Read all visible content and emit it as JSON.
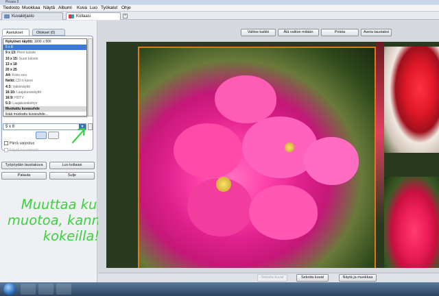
{
  "window": {
    "title": "Picasa 3"
  },
  "menu": [
    "Tiedosto",
    "Muokkaa",
    "Näytä",
    "Albumi",
    "Kuva",
    "Luo",
    "Työkalut",
    "Ohje"
  ],
  "app_tabs": [
    {
      "label": "Kuvakirjasto"
    },
    {
      "label": "Kollaasi"
    }
  ],
  "panel_tabs": {
    "settings": "Asetukset",
    "clips": "Otokset (0)"
  },
  "dropdown": {
    "items": [
      {
        "name": "Nykyinen näyttö:",
        "desc": "1600 x 900",
        "style": "head"
      },
      {
        "name": "5 x 8",
        "desc": "",
        "style": "sel"
      },
      {
        "name": "9 x 13:",
        "desc": "Pieni tuloste",
        "style": ""
      },
      {
        "name": "10 x 15:",
        "desc": "Suuri tuloste",
        "style": ""
      },
      {
        "name": "13 x 18",
        "desc": "",
        "style": ""
      },
      {
        "name": "20 x 25",
        "desc": "",
        "style": ""
      },
      {
        "name": "A4:",
        "desc": "Koko sivu",
        "style": ""
      },
      {
        "name": "Neliö:",
        "desc": "CD:n kansi",
        "style": ""
      },
      {
        "name": "4:3:",
        "desc": "Vakionäyttö",
        "style": ""
      },
      {
        "name": "16:10:",
        "desc": "Laajakuvanäyttö",
        "style": ""
      },
      {
        "name": "16:9:",
        "desc": "HDTV",
        "style": ""
      },
      {
        "name": "5:3:",
        "desc": "Laajakuvakehys",
        "style": ""
      },
      {
        "name": "Muokattu kuvasuhde",
        "desc": "",
        "style": "head grey"
      },
      {
        "name": "lisää muokattu kuvasuhde...",
        "desc": "",
        "style": ""
      }
    ],
    "selected_value": "5 x 8"
  },
  "options": {
    "draw_shadows": "Piirrä varjostus",
    "show_captions": "Näytä kuvatekstit"
  },
  "left_buttons": {
    "desktop_bg": "Työpöydän taustakuva",
    "create_collage": "Luo kollaasi",
    "back": "Palauta",
    "close": "Sulje"
  },
  "top_buttons": {
    "pick_images": "Valitse kaikki",
    "deselect": "Älä valitse mitään",
    "delete": "Poista",
    "set_bg": "Aseta taustaksi"
  },
  "bottom_buttons": {
    "disabled": "Sekoita kuvat",
    "shuffle": "Sekoita kuvat",
    "view_edit": "Näytä ja muokkaa"
  },
  "annotation": {
    "lines": [
      "Muuttaa kuvan",
      "muotoa, kannattaa",
      "kokeilla!"
    ],
    "color": "#3cd23c"
  },
  "colors": {
    "accent_border": "#e07818",
    "selection": "#3a7bd5"
  }
}
